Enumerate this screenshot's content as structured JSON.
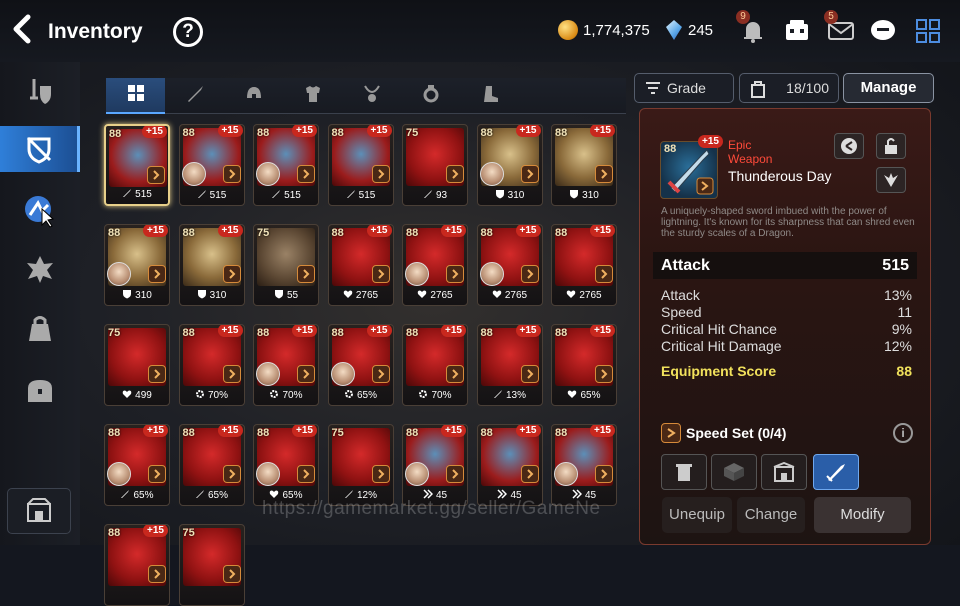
{
  "header": {
    "title": "Inventory",
    "help_label": "?",
    "gold": "1,774,375",
    "crystals": "245",
    "notice_badge": "9",
    "mail_badge": "5"
  },
  "tabs": [
    {
      "name": "all",
      "icon": "grid-icon"
    },
    {
      "name": "weapon",
      "icon": "sword-icon"
    },
    {
      "name": "helmet",
      "icon": "helmet-icon"
    },
    {
      "name": "armor",
      "icon": "armor-icon"
    },
    {
      "name": "necklace",
      "icon": "necklace-icon"
    },
    {
      "name": "ring",
      "icon": "ring-icon"
    },
    {
      "name": "boots",
      "icon": "boots-icon"
    }
  ],
  "toolbar": {
    "grade_label": "Grade",
    "count_label": "18/100",
    "manage_label": "Manage"
  },
  "items": [
    {
      "lv": "88",
      "enh": "+15",
      "stat_icon": "sword",
      "stat": "515",
      "hero": false,
      "selected": true,
      "art": "blue"
    },
    {
      "lv": "88",
      "enh": "+15",
      "stat_icon": "sword",
      "stat": "515",
      "hero": true,
      "art": "blue"
    },
    {
      "lv": "88",
      "enh": "+15",
      "stat_icon": "sword",
      "stat": "515",
      "hero": true,
      "art": "blue"
    },
    {
      "lv": "88",
      "enh": "+15",
      "stat_icon": "sword",
      "stat": "515",
      "hero": false,
      "art": "blue"
    },
    {
      "lv": "75",
      "enh": "",
      "stat_icon": "sword",
      "stat": "93",
      "hero": false,
      "art": "red"
    },
    {
      "lv": "88",
      "enh": "+15",
      "stat_icon": "shield",
      "stat": "310",
      "hero": true,
      "art": "gold"
    },
    {
      "lv": "88",
      "enh": "+15",
      "stat_icon": "shield",
      "stat": "310",
      "hero": false,
      "art": "gold"
    },
    {
      "lv": "88",
      "enh": "+15",
      "stat_icon": "shield",
      "stat": "310",
      "hero": true,
      "art": "gold"
    },
    {
      "lv": "88",
      "enh": "+15",
      "stat_icon": "shield",
      "stat": "310",
      "hero": false,
      "art": "gold"
    },
    {
      "lv": "75",
      "enh": "",
      "stat_icon": "shield",
      "stat": "55",
      "hero": false,
      "art": "brown"
    },
    {
      "lv": "88",
      "enh": "+15",
      "stat_icon": "heart",
      "stat": "2765",
      "hero": false,
      "art": "red"
    },
    {
      "lv": "88",
      "enh": "+15",
      "stat_icon": "heart",
      "stat": "2765",
      "hero": true,
      "art": "red"
    },
    {
      "lv": "88",
      "enh": "+15",
      "stat_icon": "heart",
      "stat": "2765",
      "hero": true,
      "art": "red"
    },
    {
      "lv": "88",
      "enh": "+15",
      "stat_icon": "heart",
      "stat": "2765",
      "hero": false,
      "art": "red"
    },
    {
      "lv": "75",
      "enh": "",
      "stat_icon": "heart",
      "stat": "499",
      "hero": false,
      "art": "red"
    },
    {
      "lv": "88",
      "enh": "+15",
      "stat_icon": "gear",
      "stat": "70%",
      "hero": false,
      "art": "red"
    },
    {
      "lv": "88",
      "enh": "+15",
      "stat_icon": "gear",
      "stat": "70%",
      "hero": true,
      "art": "red"
    },
    {
      "lv": "88",
      "enh": "+15",
      "stat_icon": "gear",
      "stat": "65%",
      "hero": true,
      "art": "red"
    },
    {
      "lv": "88",
      "enh": "+15",
      "stat_icon": "gear",
      "stat": "70%",
      "hero": false,
      "art": "red"
    },
    {
      "lv": "88",
      "enh": "+15",
      "stat_icon": "sword",
      "stat": "13%",
      "hero": false,
      "art": "red"
    },
    {
      "lv": "88",
      "enh": "+15",
      "stat_icon": "heart",
      "stat": "65%",
      "hero": false,
      "art": "red"
    },
    {
      "lv": "88",
      "enh": "+15",
      "stat_icon": "sword",
      "stat": "65%",
      "hero": true,
      "art": "red"
    },
    {
      "lv": "88",
      "enh": "+15",
      "stat_icon": "sword",
      "stat": "65%",
      "hero": false,
      "art": "red"
    },
    {
      "lv": "88",
      "enh": "+15",
      "stat_icon": "heart",
      "stat": "65%",
      "hero": true,
      "art": "red"
    },
    {
      "lv": "75",
      "enh": "",
      "stat_icon": "sword",
      "stat": "12%",
      "hero": false,
      "art": "red"
    },
    {
      "lv": "88",
      "enh": "+15",
      "stat_icon": "speed",
      "stat": "45",
      "hero": true,
      "art": "blue"
    },
    {
      "lv": "88",
      "enh": "+15",
      "stat_icon": "speed",
      "stat": "45",
      "hero": false,
      "art": "blue"
    },
    {
      "lv": "88",
      "enh": "+15",
      "stat_icon": "speed",
      "stat": "45",
      "hero": true,
      "art": "blue"
    },
    {
      "lv": "88",
      "enh": "+15",
      "stat_icon": "",
      "stat": "",
      "hero": false,
      "art": "red"
    },
    {
      "lv": "75",
      "enh": "",
      "stat_icon": "",
      "stat": "",
      "hero": false,
      "art": "red"
    }
  ],
  "detail": {
    "level": "88",
    "enhance": "+15",
    "rarity": "Epic",
    "type": "Weapon",
    "name": "Thunderous Day",
    "description": "A uniquely-shaped sword imbued with the power of lightning. It's known for its sharpness that can shred even the sturdy scales of a Dragon.",
    "main_stat_label": "Attack",
    "main_stat_value": "515",
    "substats": [
      {
        "label": "Attack",
        "value": "13%"
      },
      {
        "label": "Speed",
        "value": "11"
      },
      {
        "label": "Critical Hit Chance",
        "value": "9%"
      },
      {
        "label": "Critical Hit Damage",
        "value": "12%"
      }
    ],
    "score_label": "Equipment Score",
    "score_value": "88",
    "set_label": "Speed Set (0/4)",
    "unequip_label": "Unequip",
    "change_label": "Change",
    "modify_label": "Modify"
  },
  "watermark": "https://gamemarket.gg/seller/GameNe"
}
